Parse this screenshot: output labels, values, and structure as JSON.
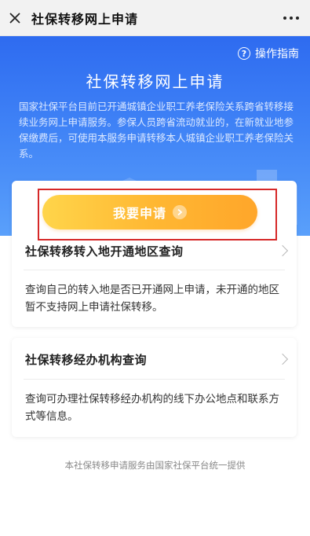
{
  "navbar": {
    "title": "社保转移网上申请",
    "close_icon": "close-icon",
    "more_icon": "more-icon"
  },
  "hero": {
    "guide_label": "操作指南",
    "guide_icon": "question-icon",
    "title": "社保转移网上申请",
    "description": "国家社保平台目前已开通城镇企业职工养老保险关系跨省转移接续业务网上申请服务。参保人员跨省流动就业的，在新就业地参保缴费后，可使用本服务申请转移本人城镇企业职工养老保险关系。"
  },
  "apply_button": {
    "label": "我要申请",
    "icon": "arrow-right-icon",
    "colors": {
      "start": "#ffd54a",
      "end": "#ffa62a"
    }
  },
  "sections": [
    {
      "title": "社保转移转入地开通地区查询",
      "description": "查询自己的转入地是否已开通网上申请，未开通的地区暂不支持网上申请社保转移。"
    },
    {
      "title": "社保转移经办机构查询",
      "description": "查询可办理社保转移经办机构的线下办公地点和联系方式等信息。"
    }
  ],
  "footer": {
    "note": "本社保转移申请服务由国家社保平台统一提供"
  },
  "colors": {
    "hero_top": "#2e6bf0",
    "hero_bottom": "#5aa0fb",
    "highlight": "#d62828"
  }
}
